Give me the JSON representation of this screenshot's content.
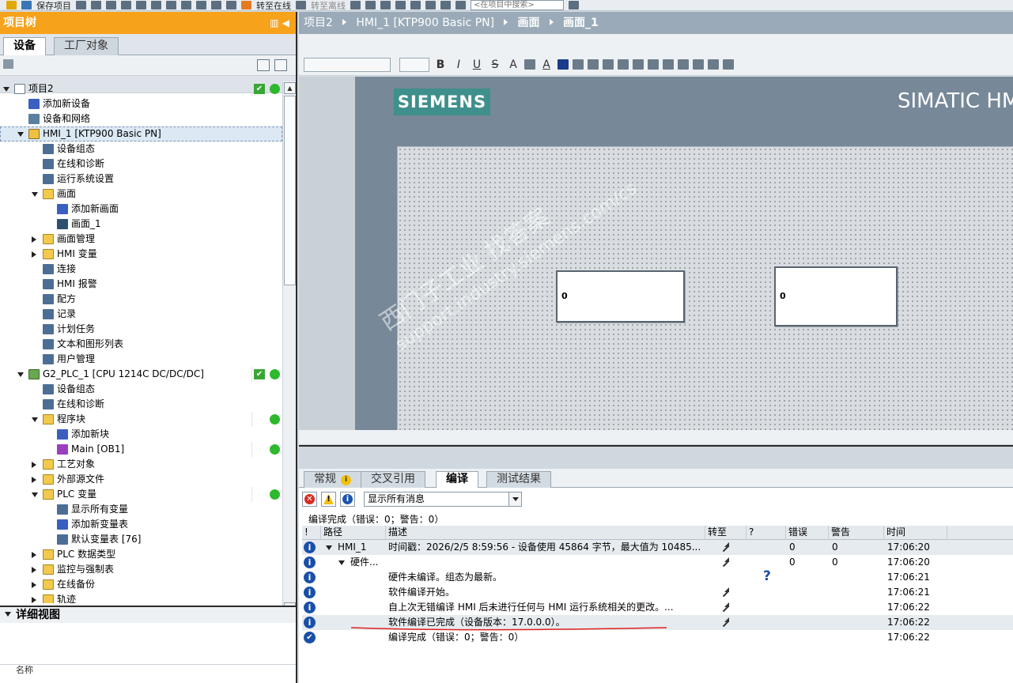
{
  "toolbar": {
    "save_project": "保存项目",
    "go_online": "转至在线",
    "go_offline": "转至离线",
    "search_placeholder": "<在项目中搜索>"
  },
  "project_tree": {
    "title": "项目树",
    "tabs": [
      "设备",
      "工厂对象"
    ],
    "items": [
      {
        "label": "项目2",
        "level": 0,
        "toggle": "exp",
        "icon": "doc",
        "check": true,
        "dot": true
      },
      {
        "label": "添加新设备",
        "level": 1,
        "toggle": "",
        "icon": "dev"
      },
      {
        "label": "设备和网络",
        "level": 1,
        "toggle": "",
        "icon": "net"
      },
      {
        "label": "HMI_1 [KTP900 Basic PN]",
        "level": 1,
        "toggle": "exp",
        "icon": "hmi",
        "selected": true
      },
      {
        "label": "设备组态",
        "level": 2,
        "toggle": "",
        "icon": "gen"
      },
      {
        "label": "在线和诊断",
        "level": 2,
        "toggle": "",
        "icon": "gen"
      },
      {
        "label": "运行系统设置",
        "level": 2,
        "toggle": "",
        "icon": "gen"
      },
      {
        "label": "画面",
        "level": 2,
        "toggle": "exp",
        "icon": "fold"
      },
      {
        "label": "添加新画面",
        "level": 3,
        "toggle": "",
        "icon": "dev"
      },
      {
        "label": "画面_1",
        "level": 3,
        "toggle": "",
        "icon": "scr"
      },
      {
        "label": "画面管理",
        "level": 2,
        "toggle": "col",
        "icon": "fold"
      },
      {
        "label": "HMI 变量",
        "level": 2,
        "toggle": "col",
        "icon": "fold"
      },
      {
        "label": "连接",
        "level": 2,
        "toggle": "",
        "icon": "gen"
      },
      {
        "label": "HMI 报警",
        "level": 2,
        "toggle": "",
        "icon": "gen"
      },
      {
        "label": "配方",
        "level": 2,
        "toggle": "",
        "icon": "gen"
      },
      {
        "label": "记录",
        "level": 2,
        "toggle": "",
        "icon": "gen"
      },
      {
        "label": "计划任务",
        "level": 2,
        "toggle": "",
        "icon": "gen"
      },
      {
        "label": "文本和图形列表",
        "level": 2,
        "toggle": "",
        "icon": "gen"
      },
      {
        "label": "用户管理",
        "level": 2,
        "toggle": "",
        "icon": "gen"
      },
      {
        "label": "G2_PLC_1 [CPU 1214C DC/DC/DC]",
        "level": 1,
        "toggle": "exp",
        "icon": "plc",
        "check": true,
        "dot": true
      },
      {
        "label": "设备组态",
        "level": 2,
        "toggle": "",
        "icon": "gen"
      },
      {
        "label": "在线和诊断",
        "level": 2,
        "toggle": "",
        "icon": "gen"
      },
      {
        "label": "程序块",
        "level": 2,
        "toggle": "exp",
        "icon": "fold",
        "dot": true
      },
      {
        "label": "添加新块",
        "level": 3,
        "toggle": "",
        "icon": "dev"
      },
      {
        "label": "Main [OB1]",
        "level": 3,
        "toggle": "",
        "icon": "blk",
        "dot": true
      },
      {
        "label": "工艺对象",
        "level": 2,
        "toggle": "col",
        "icon": "fold"
      },
      {
        "label": "外部源文件",
        "level": 2,
        "toggle": "col",
        "icon": "fold"
      },
      {
        "label": "PLC 变量",
        "level": 2,
        "toggle": "exp",
        "icon": "fold",
        "dot": true
      },
      {
        "label": "显示所有变量",
        "level": 3,
        "toggle": "",
        "icon": "gen"
      },
      {
        "label": "添加新变量表",
        "level": 3,
        "toggle": "",
        "icon": "dev"
      },
      {
        "label": "默认变量表 [76]",
        "level": 3,
        "toggle": "",
        "icon": "gen"
      },
      {
        "label": "PLC 数据类型",
        "level": 2,
        "toggle": "col",
        "icon": "fold"
      },
      {
        "label": "监控与强制表",
        "level": 2,
        "toggle": "col",
        "icon": "fold"
      },
      {
        "label": "在线备份",
        "level": 2,
        "toggle": "col",
        "icon": "fold"
      },
      {
        "label": "轨迹",
        "level": 2,
        "toggle": "col",
        "icon": "fold"
      }
    ],
    "detail_view": "详细视图",
    "detail_name_col": "名称"
  },
  "breadcrumb": [
    "项目2",
    "HMI_1 [KTP900 Basic PN]",
    "画面",
    "画面_1"
  ],
  "editor": {
    "brand": "SIEMENS",
    "product": "SIMATIC HM",
    "io_field_1": "0",
    "io_field_2": "0",
    "watermark_1": "西门子工业 找答案",
    "watermark_2": "support.industry.siemens.com/cs"
  },
  "inspector": {
    "tabs": [
      "常规",
      "交叉引用",
      "编译",
      "测试结果"
    ],
    "filter": "显示所有消息",
    "summary": "编译完成（错误：0；警告：0）",
    "columns": [
      "!",
      "路径",
      "描述",
      "转至",
      "?",
      "错误",
      "警告",
      "时间"
    ],
    "rows": [
      {
        "icon": "i",
        "path": "HMI_1",
        "toggle": true,
        "indent": 0,
        "desc": "时间戳：2026/2/5 8:59:56 - 设备使用 45864 字节，最大值为 10485...",
        "goto": true,
        "help": false,
        "errors": "0",
        "warnings": "0",
        "time": "17:06:20"
      },
      {
        "icon": "i",
        "path": "硬件...",
        "toggle": true,
        "indent": 1,
        "desc": "",
        "goto": true,
        "help": false,
        "errors": "0",
        "warnings": "0",
        "time": "17:06:20"
      },
      {
        "icon": "i",
        "path": "",
        "toggle": false,
        "indent": 0,
        "desc": "硬件未编译。组态为最新。",
        "goto": false,
        "help": true,
        "errors": "",
        "warnings": "",
        "time": "17:06:21"
      },
      {
        "icon": "i",
        "path": "",
        "toggle": false,
        "indent": 0,
        "desc": "软件编译开始。",
        "goto": true,
        "help": false,
        "errors": "",
        "warnings": "",
        "time": "17:06:21"
      },
      {
        "icon": "i",
        "path": "",
        "toggle": false,
        "indent": 0,
        "desc": "自上次无错编译 HMI 后未进行任何与 HMI 运行系统相关的更改。...",
        "goto": true,
        "help": false,
        "errors": "",
        "warnings": "",
        "time": "17:06:22"
      },
      {
        "icon": "i",
        "path": "",
        "toggle": false,
        "indent": 0,
        "desc": "软件编译已完成（设备版本：17.0.0.0）。",
        "goto": true,
        "help": false,
        "errors": "",
        "warnings": "",
        "time": "17:06:22",
        "highlight": true
      },
      {
        "icon": "ok",
        "path": "",
        "toggle": false,
        "indent": 0,
        "desc": "编译完成（错误：0；警告：0）",
        "goto": false,
        "help": false,
        "errors": "",
        "warnings": "",
        "time": "17:06:22"
      }
    ]
  },
  "colors": {
    "panel_title": "#f7a21b",
    "breadcrumb_bg": "#9aaab8",
    "hmi_frame": "#778898",
    "siemens_teal": "#3f8f8c",
    "ok_green": "#2eb82e",
    "info_blue": "#1a4fa8",
    "annotation_red": "#e02020"
  }
}
